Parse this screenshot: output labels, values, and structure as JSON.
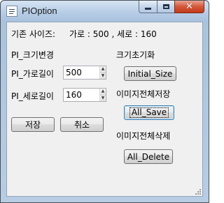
{
  "window": {
    "title": "PIOption",
    "icon": "app-window-icon",
    "close_glyph": "✕"
  },
  "size_info": {
    "label": "기존 사이즈:",
    "value": "가로 : 500 , 세로 : 160"
  },
  "pi_resize": {
    "section_title": "PI_크기변경",
    "width_label": "PI_가로길이",
    "width_value": "500",
    "height_label": "PI_세로길이",
    "height_value": "160",
    "save_label": "저장",
    "cancel_label": "취소"
  },
  "reset": {
    "section_title": "크기초기화",
    "button_label": "Initial_Size"
  },
  "save_all": {
    "section_title": "이미지전체저장",
    "button_label": "All_Save"
  },
  "delete_all": {
    "section_title": "이미지전체삭제",
    "button_label": "All_Delete"
  },
  "spin_glyphs": {
    "up": "▲",
    "down": "▼"
  }
}
